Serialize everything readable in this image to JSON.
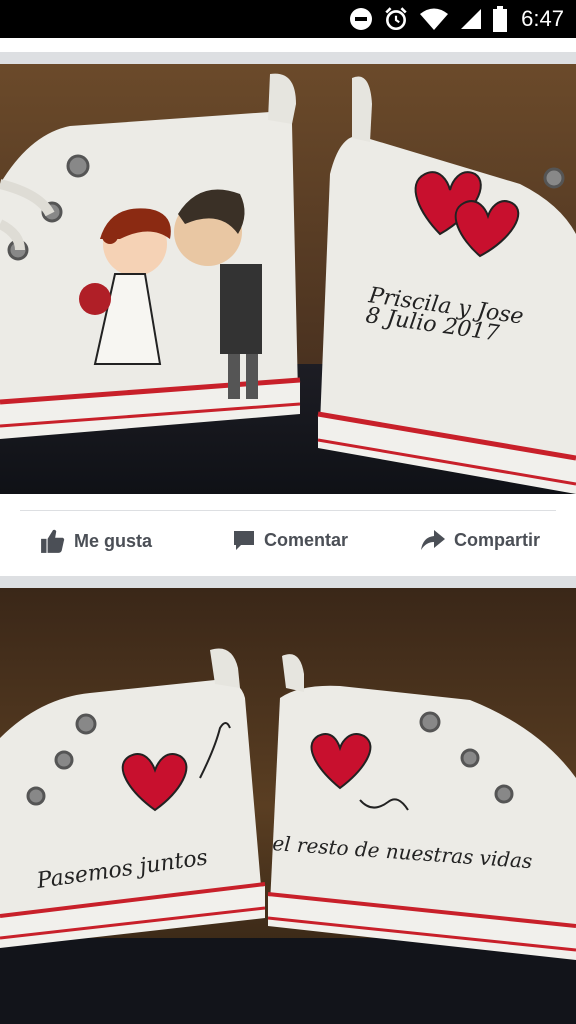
{
  "status_bar": {
    "time": "6:47",
    "icons": [
      "do-not-disturb-icon",
      "alarm-icon",
      "wifi-icon",
      "signal-icon",
      "battery-icon"
    ]
  },
  "post": {
    "photo1": {
      "handwriting_line1": "Priscila y Jose",
      "handwriting_line2": "8 Julio 2017"
    },
    "actions": {
      "like_label": "Me gusta",
      "comment_label": "Comentar",
      "share_label": "Compartir"
    },
    "photo2": {
      "left_text": "Pasemos juntos",
      "right_text": "el resto de nuestras vidas"
    }
  },
  "colors": {
    "action_text": "#4b4f56",
    "background": "#dddfe2",
    "heart_red": "#c8102e"
  }
}
